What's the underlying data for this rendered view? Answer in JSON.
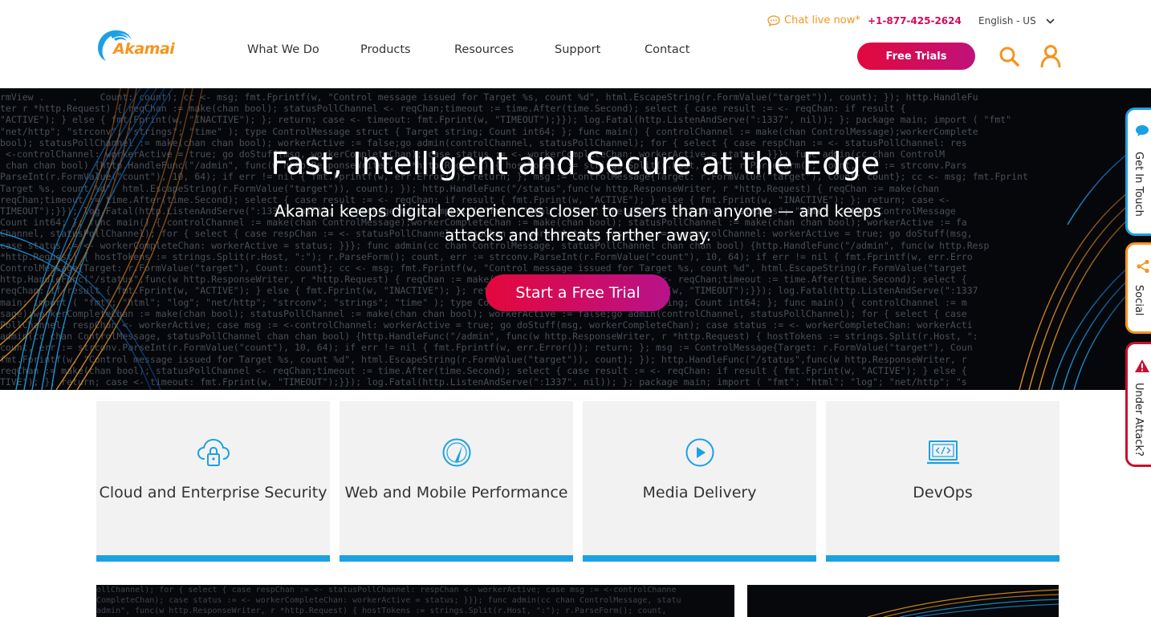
{
  "header": {
    "logo_text": "Akamai",
    "chat_label": "Chat live now*",
    "phone": "+1-877-425-2624",
    "language": "English - US",
    "free_trials_label": "Free Trials"
  },
  "nav": {
    "items": [
      {
        "label": "What We Do"
      },
      {
        "label": "Products"
      },
      {
        "label": "Resources"
      },
      {
        "label": "Support"
      },
      {
        "label": "Contact"
      }
    ]
  },
  "hero": {
    "title": "Fast, Intelligent and Secure at the Edge",
    "subtitle": "Akamai keeps digital experiences closer to users than anyone — and keeps attacks and threats farther away.",
    "cta_label": "Start a Free Trial"
  },
  "side_tabs": {
    "get_in_touch": "Get In Touch",
    "social": "Social",
    "under_attack": "Under Attack?"
  },
  "cards": [
    {
      "label": "Cloud and Enterprise Security",
      "icon": "cloud-lock-icon"
    },
    {
      "label": "Web and Mobile Performance",
      "icon": "speedometer-icon"
    },
    {
      "label": "Media Delivery",
      "icon": "play-icon"
    },
    {
      "label": "DevOps",
      "icon": "code-monitor-icon"
    }
  ],
  "colors": {
    "brand_orange": "#f7941d",
    "brand_blue": "#1ba1e2",
    "cta_gradient_start": "#e3083c",
    "cta_gradient_end": "#b8128a",
    "card_bg": "#f2f2f2"
  }
}
